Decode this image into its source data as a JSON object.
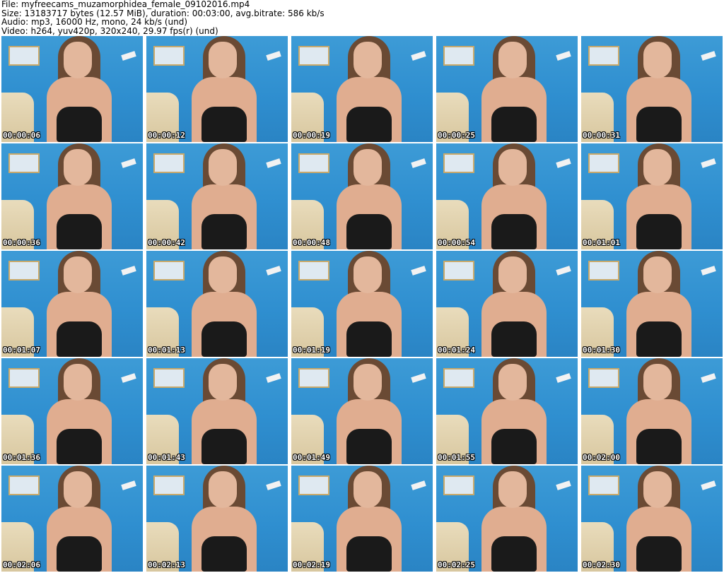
{
  "header": {
    "file_line": "File: myfreecams_muzamorphidea_female_09102016.mp4",
    "size_line": "Size: 13183717 bytes (12.57 MiB), duration: 00:03:00, avg.bitrate: 586 kb/s",
    "audio_line": "Audio: mp3, 16000 Hz, mono, 24 kb/s (und)",
    "video_line": "Video: h264, yuv420p, 320x240, 29.97 fps(r) (und)"
  },
  "thumbnails": [
    {
      "timestamp": "00:00:06"
    },
    {
      "timestamp": "00:00:12"
    },
    {
      "timestamp": "00:00:19"
    },
    {
      "timestamp": "00:00:25"
    },
    {
      "timestamp": "00:00:31"
    },
    {
      "timestamp": "00:00:36"
    },
    {
      "timestamp": "00:00:42"
    },
    {
      "timestamp": "00:00:48"
    },
    {
      "timestamp": "00:00:54"
    },
    {
      "timestamp": "00:01:01"
    },
    {
      "timestamp": "00:01:07"
    },
    {
      "timestamp": "00:01:13"
    },
    {
      "timestamp": "00:01:19"
    },
    {
      "timestamp": "00:01:24"
    },
    {
      "timestamp": "00:01:30"
    },
    {
      "timestamp": "00:01:36"
    },
    {
      "timestamp": "00:01:43"
    },
    {
      "timestamp": "00:01:49"
    },
    {
      "timestamp": "00:01:55"
    },
    {
      "timestamp": "00:02:00"
    },
    {
      "timestamp": "00:02:06"
    },
    {
      "timestamp": "00:02:13"
    },
    {
      "timestamp": "00:02:19"
    },
    {
      "timestamp": "00:02:25"
    },
    {
      "timestamp": "00:02:30"
    }
  ]
}
